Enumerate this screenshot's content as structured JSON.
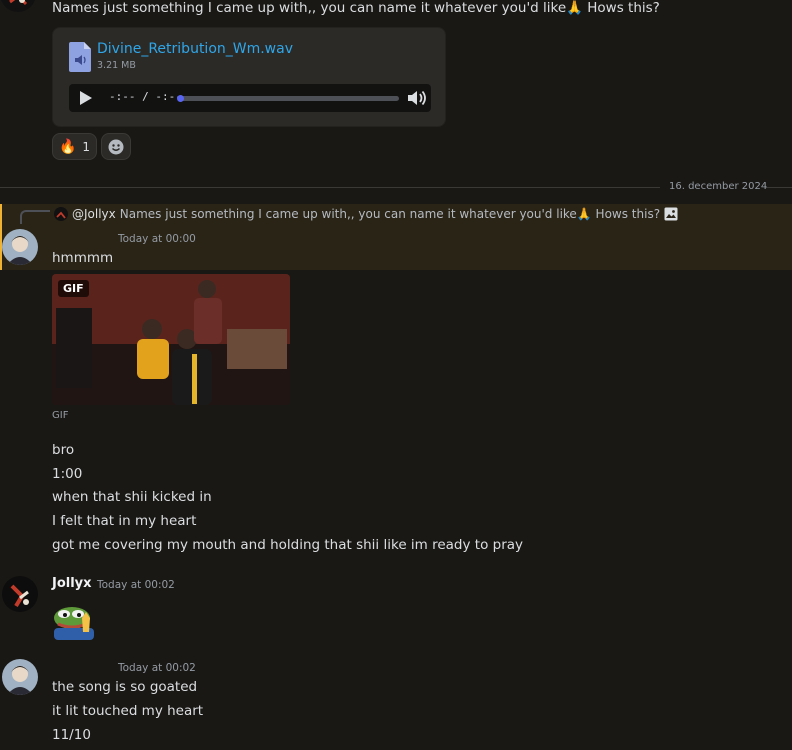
{
  "top_message": {
    "text": "Names just something I came up with,, you can name it whatever you'd like🙏 Hows this?"
  },
  "attachment": {
    "file_name": "Divine_Retribution_Wm.wav",
    "file_size": "3.21 MB",
    "time_display": "-:-- / -:--",
    "icon": "audio-file-icon"
  },
  "reactions": [
    {
      "emoji": "🔥",
      "count": "1"
    },
    {
      "emoji": "☻",
      "count": ""
    }
  ],
  "divider": {
    "date": "16. december 2024"
  },
  "reply": {
    "user": "@Jollyx",
    "text": "Names just something I came up with,, you can name it whatever you'd like🙏 Hows this?"
  },
  "msg1": {
    "timestamp": "Today at 00:00",
    "first": "hmmmm",
    "gif_badge": "GIF",
    "gif_caption": "GIF",
    "lines": [
      "bro",
      "1:00",
      "when that shii kicked in",
      "I felt that in my heart",
      "got me covering my mouth and holding that shii like im ready to pray"
    ]
  },
  "msg2": {
    "username": "Jollyx",
    "timestamp": "Today at 00:02"
  },
  "msg3": {
    "timestamp": "Today at 00:02",
    "lines": [
      "the song is so goated",
      "it lit touched my heart",
      "11/10"
    ]
  },
  "colors": {
    "background": "#1a1814",
    "link": "#2fa6e8",
    "highlight": "#2a2417",
    "highlight_bar": "#f0b232"
  }
}
